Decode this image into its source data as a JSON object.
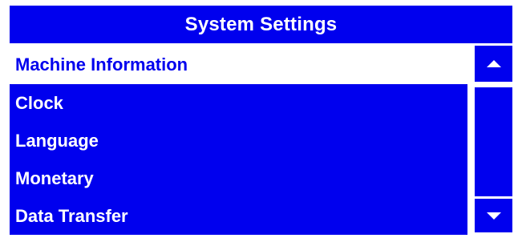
{
  "header": {
    "title": "System Settings"
  },
  "menu": {
    "items": [
      {
        "label": "Machine Information",
        "selected": true
      },
      {
        "label": "Clock",
        "selected": false
      },
      {
        "label": "Language",
        "selected": false
      },
      {
        "label": "Monetary",
        "selected": false
      },
      {
        "label": "Data Transfer",
        "selected": false
      }
    ]
  },
  "scroll": {
    "up_icon": "arrow-up-icon",
    "down_icon": "arrow-down-icon"
  },
  "colors": {
    "accent": "#0000ee",
    "text_on_accent": "#ffffff",
    "background": "#ffffff"
  }
}
